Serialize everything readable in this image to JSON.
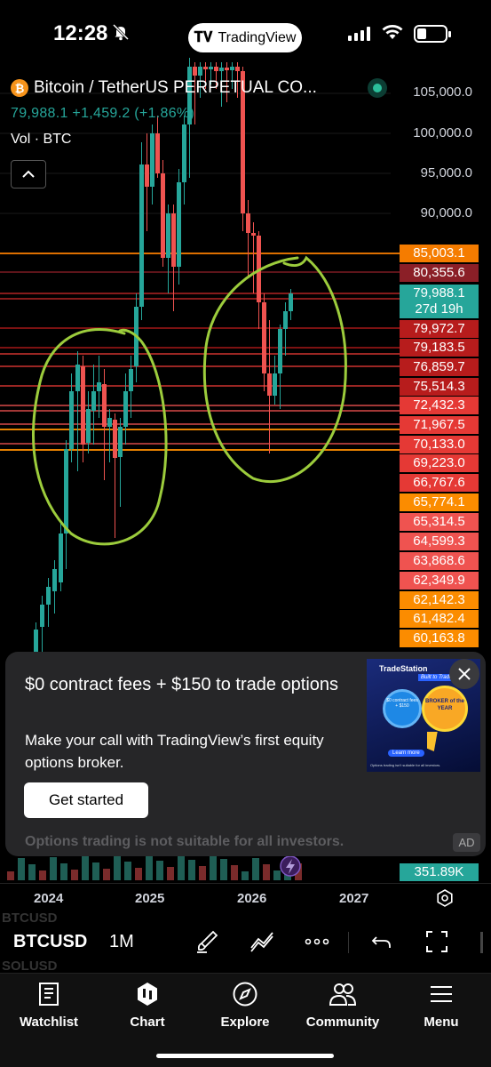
{
  "status_bar": {
    "time": "12:28",
    "app_pill": "TradingView"
  },
  "chart": {
    "symbol_title": "Bitcoin / TetherUS PERPETUAL CO...",
    "price_line": "79,988.1 +1,459.2 (+1.86%)",
    "volume_label": "Vol · BTC",
    "axis_prices": [
      "105,000.0",
      "100,000.0",
      "95,000.0",
      "90,000.0"
    ],
    "tags": [
      {
        "value": "85,003.1",
        "color": "#f57c00"
      },
      {
        "value": "80,355.6",
        "color": "#8b1f27"
      },
      {
        "value": "79,972.7",
        "color": "#b71c1c"
      },
      {
        "value": "79,183.5",
        "color": "#b71c1c"
      },
      {
        "value": "76,859.7",
        "color": "#b71c1c"
      },
      {
        "value": "75,514.3",
        "color": "#b71c1c"
      },
      {
        "value": "72,432.3",
        "color": "#e53935"
      },
      {
        "value": "71,967.5",
        "color": "#e53935"
      },
      {
        "value": "70,133.0",
        "color": "#e53935"
      },
      {
        "value": "69,223.0",
        "color": "#e53935"
      },
      {
        "value": "66,767.6",
        "color": "#e53935"
      },
      {
        "value": "65,774.1",
        "color": "#fb8c00"
      },
      {
        "value": "65,314.5",
        "color": "#ef5350"
      },
      {
        "value": "64,599.3",
        "color": "#ef5350"
      },
      {
        "value": "63,868.6",
        "color": "#ef5350"
      },
      {
        "value": "62,349.9",
        "color": "#ef5350"
      },
      {
        "value": "62,142.3",
        "color": "#fb8c00"
      },
      {
        "value": "61,482.4",
        "color": "#fb8c00"
      },
      {
        "value": "60,163.8",
        "color": "#fb8c00"
      }
    ],
    "current_price": "79,988.1",
    "countdown": "27d 19h",
    "volume_value": "351.89K"
  },
  "ad": {
    "title": "$0 contract fees + $150 to trade options",
    "body": "Make your call with TradingView’s first equity options broker.",
    "cta": "Get started",
    "disclaimer": "Options trading is not suitable for all investors.",
    "badge": "AD",
    "image_brand": "TradeStation",
    "image_ribbon": "Built to Trade",
    "image_badge_left": "$0 contract fees + $150",
    "image_badge_right": "BROKER of the YEAR",
    "image_learn_more": "Learn more",
    "image_footnote": "Options trading isn't suitable for all investors."
  },
  "time_axis": {
    "years": [
      "2024",
      "2025",
      "2026",
      "2027"
    ]
  },
  "toolbar": {
    "ghost_symbol_top": "BTCUSD",
    "symbol": "BTCUSD",
    "ghost_symbol_bottom": "SOLUSD",
    "interval": "1M"
  },
  "nav": {
    "items": [
      {
        "label": "Watchlist",
        "icon": "watchlist-icon"
      },
      {
        "label": "Chart",
        "icon": "chart-icon"
      },
      {
        "label": "Explore",
        "icon": "compass-icon"
      },
      {
        "label": "Community",
        "icon": "community-icon"
      },
      {
        "label": "Menu",
        "icon": "menu-icon"
      }
    ]
  },
  "colors": {
    "up": "#26a69a",
    "down": "#ef5350",
    "annotation": "#9ccc3c",
    "level_orange": "#ff8f00"
  }
}
